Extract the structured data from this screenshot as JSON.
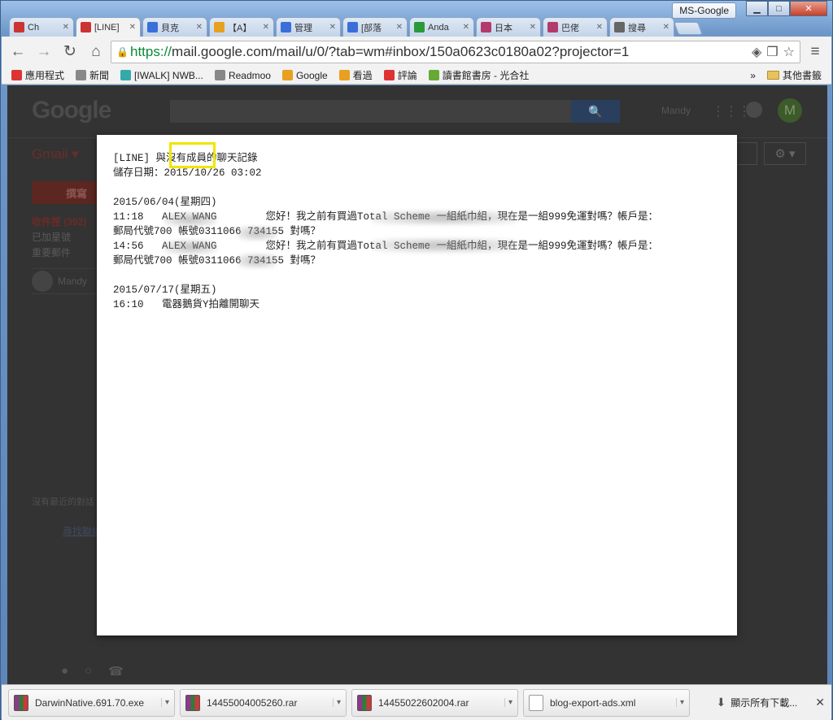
{
  "window": {
    "profile": "MS-Google",
    "minimize": "▁",
    "maximize": "□",
    "close": "✕"
  },
  "tabs": [
    {
      "label": "Ch",
      "fav": "#c33"
    },
    {
      "label": "[LINE]",
      "fav": "#c33",
      "active": true
    },
    {
      "label": "貝克",
      "fav": "#3a6fd8"
    },
    {
      "label": "【A】",
      "fav": "#e8a020"
    },
    {
      "label": "管理",
      "fav": "#3a6fd8"
    },
    {
      "label": "[部落",
      "fav": "#3a6fd8"
    },
    {
      "label": "Anda",
      "fav": "#2a9a3a"
    },
    {
      "label": "日本",
      "fav": "#b33a6a"
    },
    {
      "label": "巴佬",
      "fav": "#b33a6a"
    },
    {
      "label": "搜尋",
      "fav": "#666"
    }
  ],
  "toolbar": {
    "back": "←",
    "forward": "→",
    "reload": "↻",
    "home": "⌂",
    "url_scheme": "https://",
    "url_rest": "mail.google.com/mail/u/0/?tab=wm#inbox/150a0623c0180a02?projector=1",
    "star": "☆",
    "menu": "≡"
  },
  "bookmarks": {
    "items": [
      "應用程式",
      "新聞",
      "[IWALK] NWB...",
      "Readmoo",
      "Google",
      "看過",
      "評論",
      "讀書館書房 - 光合社"
    ],
    "more": "»",
    "other": "其他書籤"
  },
  "gmail": {
    "logo": "Google",
    "user": "Mandy",
    "avatar": "M",
    "app_name": "Gmail ▾",
    "compose": "撰寫",
    "inbox": "收件匣 (392)",
    "starred": "已加星號",
    "important": "重要郵件",
    "hangout_name": "Mandy",
    "no_chat": "沒有最近的對話",
    "find": "尋找聯絡人"
  },
  "document": {
    "lines": [
      "[LINE] 與沒有成員的聊天記錄",
      "儲存日期：2015/10/26 03:02",
      "",
      "2015/06/04(星期四)",
      "11:18   ALEX WANG        您好！我之前有買過Total Scheme 一組紙巾組，現在是一組999免運對嗎？帳戶是：",
      "郵局代號700 帳號0311066 734155 對嗎？",
      "14:56   ALEX WANG        您好！我之前有買過Total Scheme 一組紙巾組，現在是一組999免運對嗎？帳戶是：",
      "郵局代號700 帳號0311066 734155 對嗎？",
      "",
      "2015/07/17(星期五)",
      "16:10   電器鵝貨Y拍離開聊天"
    ]
  },
  "downloads": {
    "items": [
      {
        "name": "DarwinNative.691.70.exe"
      },
      {
        "name": "14455004005260.rar"
      },
      {
        "name": "14455022602004.rar"
      },
      {
        "name": "blog-export-ads.xml"
      }
    ],
    "show_all": "顯示所有下載...",
    "close": "✕"
  }
}
